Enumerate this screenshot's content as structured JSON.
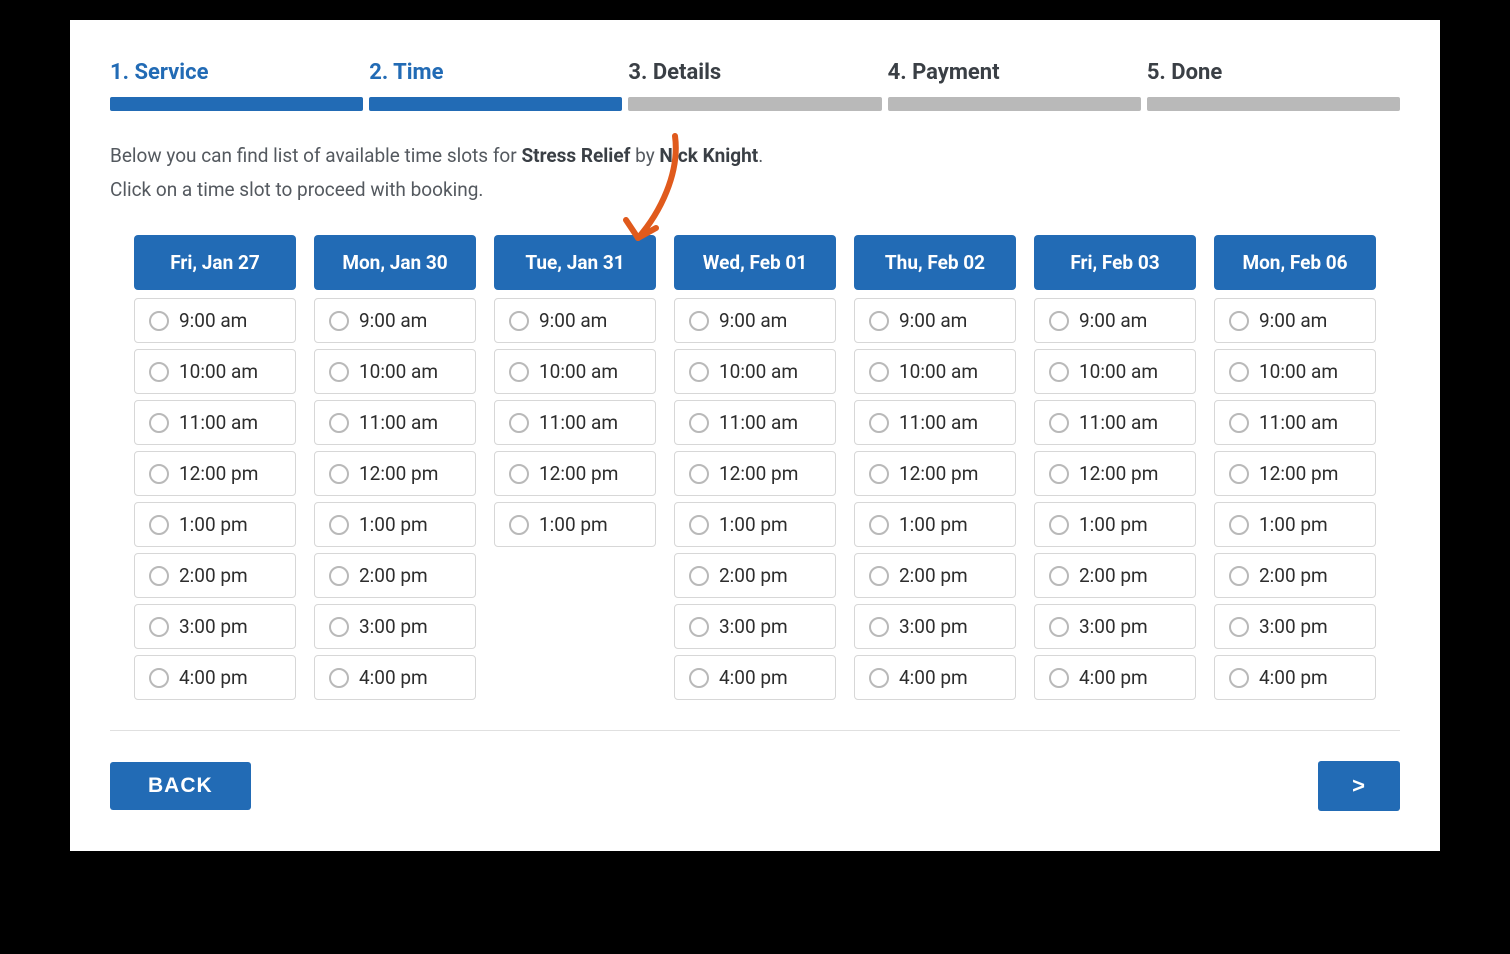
{
  "steps": [
    {
      "label": "1. Service",
      "active": true
    },
    {
      "label": "2. Time",
      "active": true
    },
    {
      "label": "3. Details",
      "active": false
    },
    {
      "label": "4. Payment",
      "active": false
    },
    {
      "label": "5. Done",
      "active": false
    }
  ],
  "intro": {
    "prefix": "Below you can find list of available time slots for ",
    "service": "Stress Relief",
    "mid": " by ",
    "provider": "Nick Knight",
    "suffix": ".",
    "line2": "Click on a time slot to proceed with booking."
  },
  "days": [
    {
      "header": "Fri, Jan 27",
      "slots": [
        "9:00 am",
        "10:00 am",
        "11:00 am",
        "12:00 pm",
        "1:00 pm",
        "2:00 pm",
        "3:00 pm",
        "4:00 pm"
      ]
    },
    {
      "header": "Mon, Jan 30",
      "slots": [
        "9:00 am",
        "10:00 am",
        "11:00 am",
        "12:00 pm",
        "1:00 pm",
        "2:00 pm",
        "3:00 pm",
        "4:00 pm"
      ]
    },
    {
      "header": "Tue, Jan 31",
      "slots": [
        "9:00 am",
        "10:00 am",
        "11:00 am",
        "12:00 pm",
        "1:00 pm"
      ]
    },
    {
      "header": "Wed, Feb 01",
      "slots": [
        "9:00 am",
        "10:00 am",
        "11:00 am",
        "12:00 pm",
        "1:00 pm",
        "2:00 pm",
        "3:00 pm",
        "4:00 pm"
      ]
    },
    {
      "header": "Thu, Feb 02",
      "slots": [
        "9:00 am",
        "10:00 am",
        "11:00 am",
        "12:00 pm",
        "1:00 pm",
        "2:00 pm",
        "3:00 pm",
        "4:00 pm"
      ]
    },
    {
      "header": "Fri, Feb 03",
      "slots": [
        "9:00 am",
        "10:00 am",
        "11:00 am",
        "12:00 pm",
        "1:00 pm",
        "2:00 pm",
        "3:00 pm",
        "4:00 pm"
      ]
    },
    {
      "header": "Mon, Feb 06",
      "slots": [
        "9:00 am",
        "10:00 am",
        "11:00 am",
        "12:00 pm",
        "1:00 pm",
        "2:00 pm",
        "3:00 pm",
        "4:00 pm"
      ]
    }
  ],
  "buttons": {
    "back": "BACK",
    "next": ">"
  },
  "colors": {
    "primary": "#226bb5",
    "muted": "#b9b9b9",
    "annotation": "#e05a1c"
  }
}
